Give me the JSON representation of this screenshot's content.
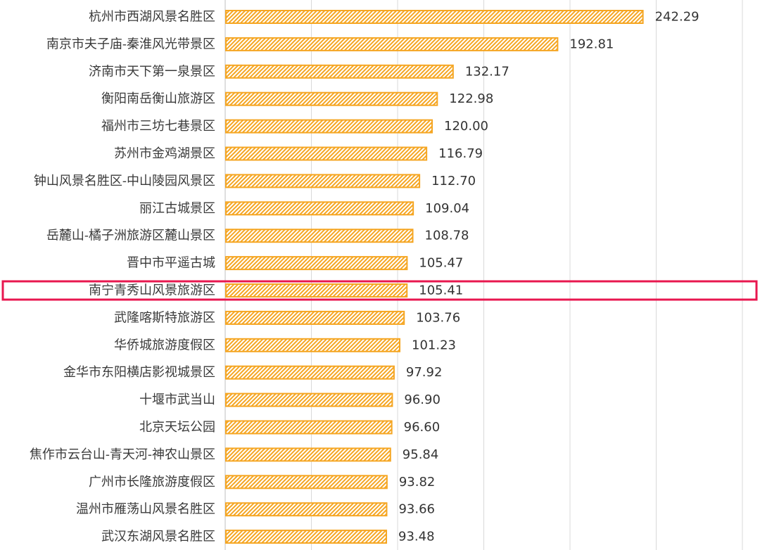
{
  "chart_data": {
    "type": "bar",
    "orientation": "horizontal",
    "categories": [
      "杭州市西湖风景名胜区",
      "南京市夫子庙-秦淮风光带景区",
      "济南市天下第一泉景区",
      "衡阳南岳衡山旅游区",
      "福州市三坊七巷景区",
      "苏州市金鸡湖景区",
      "钟山风景名胜区-中山陵园风景区",
      "丽江古城景区",
      "岳麓山-橘子洲旅游区麓山景区",
      "晋中市平遥古城",
      "南宁青秀山风景旅游区",
      "武隆喀斯特旅游区",
      "华侨城旅游度假区",
      "金华市东阳横店影视城景区",
      "十堰市武当山",
      "北京天坛公园",
      "焦作市云台山-青天河-神农山景区",
      "广州市长隆旅游度假区",
      "温州市雁荡山风景名胜区",
      "武汉东湖风景名胜区"
    ],
    "values": [
      242.29,
      192.81,
      132.17,
      122.98,
      120.0,
      116.79,
      112.7,
      109.04,
      108.78,
      105.47,
      105.41,
      103.76,
      101.23,
      97.92,
      96.9,
      96.6,
      95.84,
      93.82,
      93.66,
      93.48
    ],
    "value_labels": [
      "242.29",
      "192.81",
      "132.17",
      "122.98",
      "120.00",
      "116.79",
      "112.70",
      "109.04",
      "108.78",
      "105.47",
      "105.41",
      "103.76",
      "101.23",
      "97.92",
      "96.90",
      "96.60",
      "95.84",
      "93.82",
      "93.66",
      "93.48"
    ],
    "xlim": [
      0,
      300
    ],
    "grid": true,
    "bar_color": "#F5A623",
    "bar_pattern": "diagonal-hatch",
    "highlight_index": 10,
    "highlight_color": "#E8174F"
  }
}
